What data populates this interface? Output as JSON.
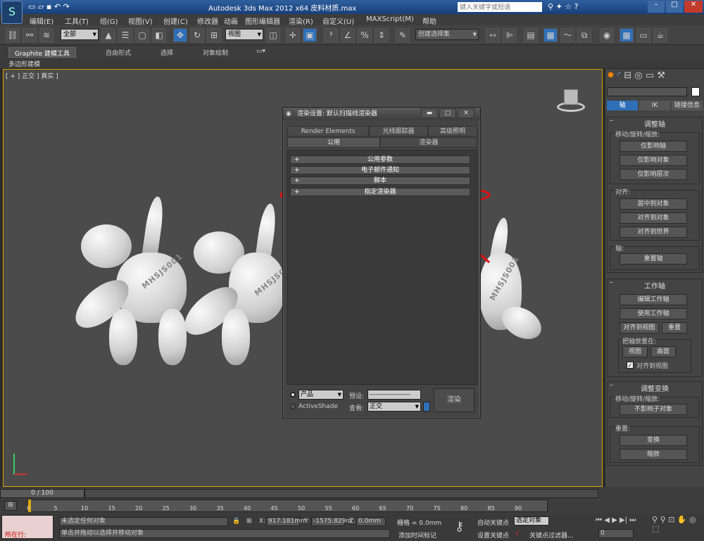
{
  "titlebar": {
    "title": "Autodesk 3ds Max  2012 x64      皮料材质.max",
    "search_placeholder": "键入关键字或短语"
  },
  "menubar": [
    "编辑(E)",
    "工具(T)",
    "组(G)",
    "视图(V)",
    "创建(C)",
    "修改器",
    "动画",
    "图形编辑器",
    "渲染(R)",
    "自定义(U)",
    "MAXScript(M)",
    "帮助"
  ],
  "toolbar": {
    "filter_select": "全部",
    "refcoord_select": "视图",
    "named_selection": "创建选择集"
  },
  "ribbon": {
    "tabs": [
      "Graphite 建模工具",
      "自由形式",
      "选择",
      "对象绘制"
    ],
    "sub_label": "多边形建模"
  },
  "viewport": {
    "label": "[ + ] 正交 ] 真实 ]",
    "model_text": "MHSJS001"
  },
  "dialog": {
    "title": "渲染设置: 默认扫描线渲染器",
    "tabs_row1": [
      "Render Elements",
      "光线跟踪器",
      "高级照明"
    ],
    "tabs_row2": [
      "公用",
      "渲染器"
    ],
    "rollouts": [
      "公用参数",
      "电子邮件通知",
      "脚本",
      "指定渲染器"
    ],
    "mode_product": "产品",
    "mode_activeshade": "ActiveShade",
    "preset_label": "预设:",
    "preset_value": "--------------------",
    "view_label": "查看:",
    "view_value": "正交",
    "render_button": "渲染"
  },
  "cmdpanel": {
    "tabs": [
      "轴",
      "IK",
      "链接信息"
    ],
    "adjust_pivot": {
      "header": "调整轴",
      "group_move": "移动/旋转/缩放:",
      "btn_pivot_only": "仅影响轴",
      "btn_object_only": "仅影响对象",
      "btn_hierarchy_only": "仅影响层次",
      "group_align": "对齐:",
      "btn_center": "居中到对象",
      "btn_align_object": "对齐到对象",
      "btn_align_world": "对齐到世界",
      "group_pivot": "轴:",
      "btn_reset_pivot": "重置轴"
    },
    "working_pivot": {
      "header": "工作轴",
      "btn_edit": "编辑工作轴",
      "btn_use": "使用工作轴",
      "btn_align_view": "对齐到视图",
      "btn_reset": "重置",
      "group_place": "把轴放置在:",
      "btn_view": "视图",
      "btn_surface": "曲面",
      "chk_align_view": "对齐到视图"
    },
    "adjust_transform": {
      "header": "调整变换",
      "group_move": "移动/旋转/缩放:",
      "btn_dont_affect": "不影响子对象",
      "group_reset": "重置:",
      "btn_transform": "变换",
      "btn_scale": "缩放"
    }
  },
  "timeline": {
    "frame_counter": "0 / 100",
    "ticks": [
      "0",
      "5",
      "10",
      "15",
      "20",
      "25",
      "30",
      "35",
      "40",
      "45",
      "50",
      "55",
      "60",
      "65",
      "70",
      "75",
      "80",
      "85",
      "90"
    ]
  },
  "status": {
    "script_label": "所在行:",
    "message1": "未选定任何对象",
    "message2": "单击并拖动以选择并移动对象",
    "x_value": "917.181mm",
    "y_value": "-1575.829m",
    "z_value": "0.0mm",
    "grid": "栅格 = 0.0mm",
    "add_time_tag": "添加时间标记",
    "autokey": "自动关键点",
    "selected": "选定对象",
    "set_key": "设置关键点",
    "key_filters": "关键点过滤器...",
    "frame": "0"
  },
  "colors": {
    "accent_yellow": "#d9a300",
    "active_blue": "#2f6fb8",
    "annotation_red": "#e01010"
  }
}
